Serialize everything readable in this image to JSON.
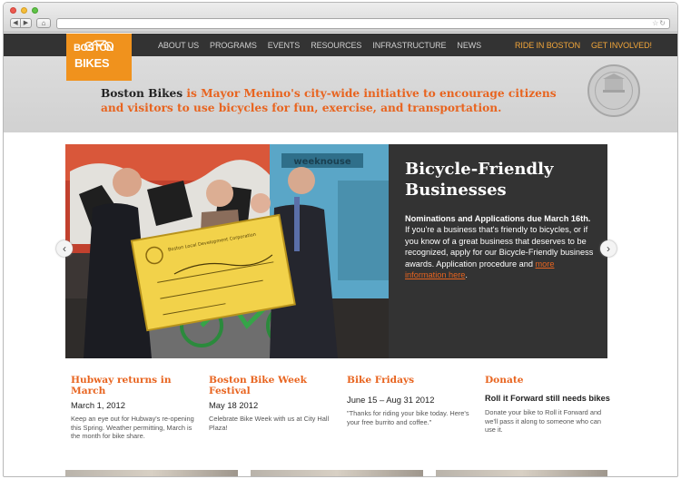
{
  "nav": {
    "logo": {
      "line1": "BOSTON",
      "line2": "BIKES"
    },
    "items": [
      {
        "label": "ABOUT US"
      },
      {
        "label": "PROGRAMS"
      },
      {
        "label": "EVENTS"
      },
      {
        "label": "RESOURCES"
      },
      {
        "label": "INFRASTRUCTURE"
      },
      {
        "label": "NEWS"
      },
      {
        "label": "RIDE IN BOSTON"
      },
      {
        "label": "GET INVOLVED!"
      }
    ]
  },
  "banner": {
    "lead": "Boston Bikes",
    "tagline": " is Mayor Menino's city-wide initiative to encourage citizens and visitors to use bicycles for fun, exercise, and transportation."
  },
  "hero": {
    "title": "Bicycle-Friendly Businesses",
    "lead": "Nominations and Applications due March 16th.",
    "body": " If you're a business that's friendly to bicycles, or if you know of a great business that deserves to be recognized, apply for our Bicycle-Friendly business awards. Application procedure and ",
    "link": "more information here",
    "tail": ".",
    "photo": {
      "wall_text": "weeknouse",
      "check_text": "Boston Local Development Corporation"
    }
  },
  "columns": [
    {
      "title": "Hubway returns in March",
      "date": "March 1, 2012",
      "desc": "Keep an eye out for Hubway's re-opening this Spring. Weather permitting, March is the month for bike share."
    },
    {
      "title": "Boston Bike Week Festival",
      "date": "May 18 2012",
      "desc": "Celebrate Bike Week with us at City Hall Plaza!"
    },
    {
      "title": "Bike Fridays",
      "date": "June 15 – Aug 31 2012",
      "desc": "\"Thanks for riding your bike today. Here's your free burrito and coffee.\""
    },
    {
      "title": "Donate",
      "subtitle": "Roll it Forward still needs bikes",
      "desc": "Donate your bike to Roll it Forward and we'll pass it along to someone who can use it."
    }
  ],
  "colors": {
    "accent": "#e8641f",
    "logo": "#f0921d",
    "nav": "#333333",
    "banner": "#d7d7d7"
  }
}
